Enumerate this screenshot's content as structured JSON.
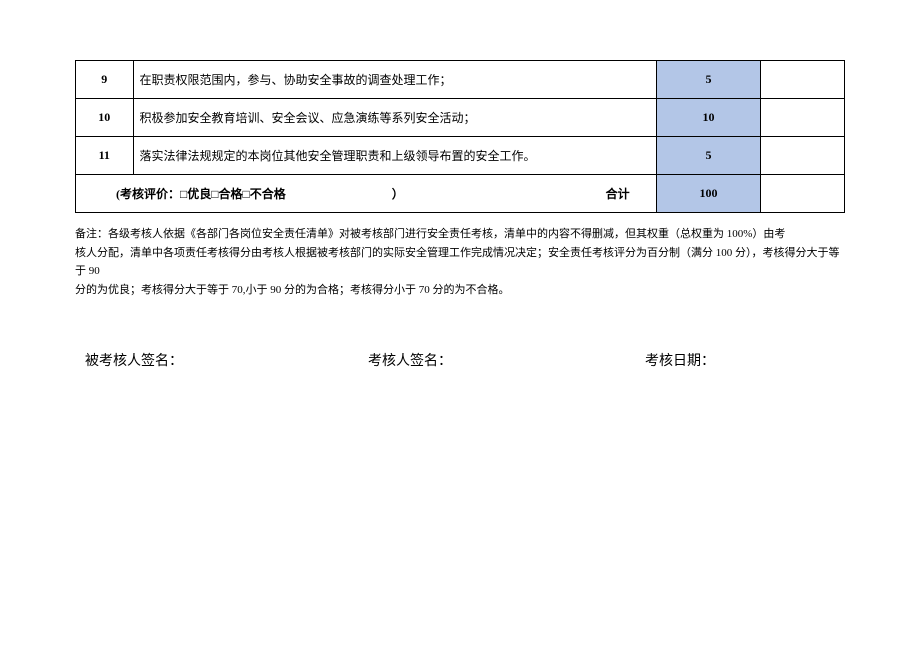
{
  "table": {
    "rows": [
      {
        "num": "9",
        "desc": "在职责权限范围内，参与、协助安全事故的调查处理工作；",
        "score": "5"
      },
      {
        "num": "10",
        "desc": "积极参加安全教育培训、安全会议、应急演练等系列安全活动；",
        "score": "10"
      },
      {
        "num": "11",
        "desc": "落实法律法规规定的本岗位其他安全管理职责和上级领导布置的安全工作。",
        "score": "5"
      }
    ],
    "summary": {
      "label_left": "(考核评价：□优良□合格□不合格",
      "label_paren": "）",
      "label_right": "合计",
      "total": "100"
    }
  },
  "notes": {
    "line1": "备注：各级考核人依据《各部门各岗位安全责任清单》对被考核部门进行安全责任考核，清单中的内容不得删减，但其权重（总权重为 100%）由考",
    "line2": "核人分配，清单中各项责任考核得分由考核人根据被考核部门的实际安全管理工作完成情况决定；安全责任考核评分为百分制（满分 100 分），考核得分大于等于 90",
    "line3": "分的为优良；考核得分大于等于 70,小于 90 分的为合格；考核得分小于 70 分的为不合格。"
  },
  "signatures": {
    "assessee": "被考核人签名：",
    "assessor": "考核人签名：",
    "date": "考核日期："
  }
}
